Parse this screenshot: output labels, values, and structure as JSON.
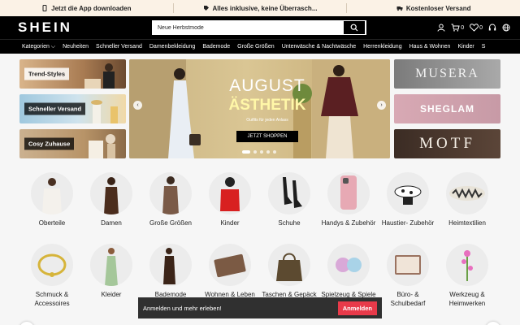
{
  "promo_bar": {
    "items": [
      {
        "icon": "phone-icon",
        "text": "Jetzt die App downloaden"
      },
      {
        "icon": "tag-icon",
        "text": "Alles inklusive, keine Überrasch..."
      },
      {
        "icon": "truck-icon",
        "text": "Kostenloser Versand"
      }
    ]
  },
  "header": {
    "logo": "SHEIN",
    "search": {
      "value": "Neue Herbstmode"
    },
    "cart_count": "0",
    "wishlist_count": "0"
  },
  "nav": {
    "items": [
      "Kategorien",
      "Neuheiten",
      "Schneller Versand",
      "Damenbekleidung",
      "Bademode",
      "Große Größen",
      "Unterwäsche & Nachtwäsche",
      "Herrenkleidung",
      "Haus & Wohnen",
      "Kinder",
      "S"
    ]
  },
  "left_banners": [
    {
      "label": "Trend-Styles"
    },
    {
      "label": "Schneller Versand"
    },
    {
      "label": "Cosy Zuhause"
    }
  ],
  "hero": {
    "title_line1": "AUGUST",
    "title_line2": "ÄSTHETIK",
    "subtitle": "Outfits für jeden Anlass",
    "button": "JETZT SHOPPEN",
    "slide_count": 5,
    "active_slide": 1
  },
  "right_banners": [
    {
      "label": "MUSERA"
    },
    {
      "label": "SHEGLAM"
    },
    {
      "label": "MOTF"
    }
  ],
  "categories": {
    "row1": [
      {
        "label": "Oberteile"
      },
      {
        "label": "Damen"
      },
      {
        "label": "Große Größen"
      },
      {
        "label": "Kinder"
      },
      {
        "label": "Schuhe"
      },
      {
        "label": "Handys & Zubehör"
      },
      {
        "label": "Haustier- Zubehör"
      },
      {
        "label": "Heimtextilien"
      }
    ],
    "row2": [
      {
        "label": "Schmuck & Accessoires"
      },
      {
        "label": "Kleider"
      },
      {
        "label": "Bademode"
      },
      {
        "label": "Wohnen & Leben"
      },
      {
        "label": "Taschen & Gepäck"
      },
      {
        "label": "Spielzeug & Spiele"
      },
      {
        "label": "Büro- & Schulbedarf"
      },
      {
        "label": "Werkzeug & Heimwerken"
      }
    ]
  },
  "toast": {
    "text": "Anmelden und mehr erleben!",
    "button": "Anmelden"
  },
  "colors": {
    "promo_bg": "#fbf2e6",
    "header_bg": "#000000",
    "accent": "#e83a4a"
  }
}
